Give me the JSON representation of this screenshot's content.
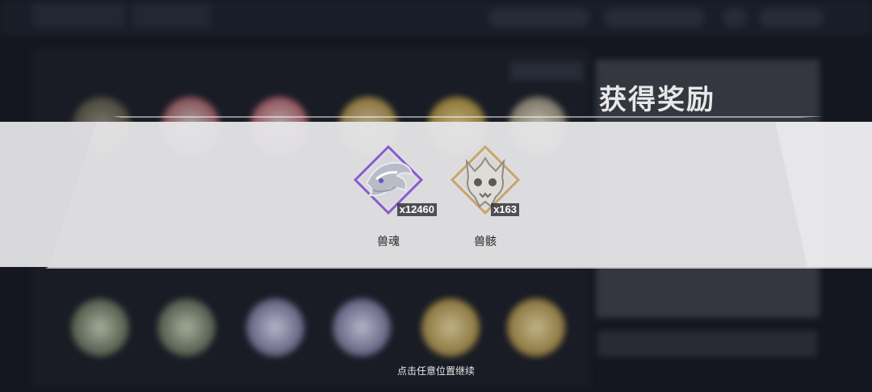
{
  "overlay": {
    "title": "获得奖励",
    "continue_hint": "点击任意位置继续"
  },
  "rewards": [
    {
      "name": "兽魂",
      "count": "x12460",
      "icon": "beast-soul-icon"
    },
    {
      "name": "兽骸",
      "count": "x163",
      "icon": "beast-bones-icon"
    }
  ],
  "colors": {
    "banner": "#e9e9eb",
    "backdrop": "#14171f",
    "soul_frame": "#8a5bd0",
    "bone_frame": "#c9a46a"
  }
}
